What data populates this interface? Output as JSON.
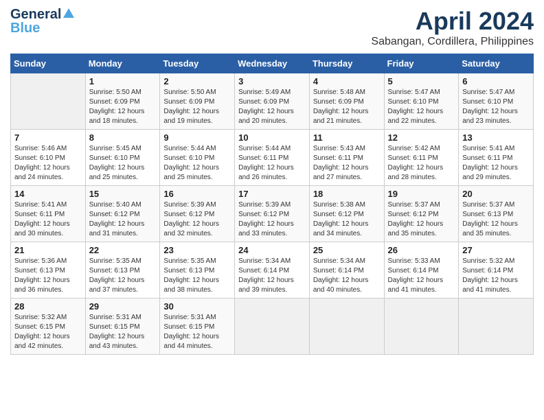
{
  "logo": {
    "line1": "General",
    "line2": "Blue"
  },
  "title": "April 2024",
  "subtitle": "Sabangan, Cordillera, Philippines",
  "days_of_week": [
    "Sunday",
    "Monday",
    "Tuesday",
    "Wednesday",
    "Thursday",
    "Friday",
    "Saturday"
  ],
  "weeks": [
    [
      {
        "num": "",
        "detail": ""
      },
      {
        "num": "1",
        "detail": "Sunrise: 5:50 AM\nSunset: 6:09 PM\nDaylight: 12 hours\nand 18 minutes."
      },
      {
        "num": "2",
        "detail": "Sunrise: 5:50 AM\nSunset: 6:09 PM\nDaylight: 12 hours\nand 19 minutes."
      },
      {
        "num": "3",
        "detail": "Sunrise: 5:49 AM\nSunset: 6:09 PM\nDaylight: 12 hours\nand 20 minutes."
      },
      {
        "num": "4",
        "detail": "Sunrise: 5:48 AM\nSunset: 6:09 PM\nDaylight: 12 hours\nand 21 minutes."
      },
      {
        "num": "5",
        "detail": "Sunrise: 5:47 AM\nSunset: 6:10 PM\nDaylight: 12 hours\nand 22 minutes."
      },
      {
        "num": "6",
        "detail": "Sunrise: 5:47 AM\nSunset: 6:10 PM\nDaylight: 12 hours\nand 23 minutes."
      }
    ],
    [
      {
        "num": "7",
        "detail": "Sunrise: 5:46 AM\nSunset: 6:10 PM\nDaylight: 12 hours\nand 24 minutes."
      },
      {
        "num": "8",
        "detail": "Sunrise: 5:45 AM\nSunset: 6:10 PM\nDaylight: 12 hours\nand 25 minutes."
      },
      {
        "num": "9",
        "detail": "Sunrise: 5:44 AM\nSunset: 6:10 PM\nDaylight: 12 hours\nand 25 minutes."
      },
      {
        "num": "10",
        "detail": "Sunrise: 5:44 AM\nSunset: 6:11 PM\nDaylight: 12 hours\nand 26 minutes."
      },
      {
        "num": "11",
        "detail": "Sunrise: 5:43 AM\nSunset: 6:11 PM\nDaylight: 12 hours\nand 27 minutes."
      },
      {
        "num": "12",
        "detail": "Sunrise: 5:42 AM\nSunset: 6:11 PM\nDaylight: 12 hours\nand 28 minutes."
      },
      {
        "num": "13",
        "detail": "Sunrise: 5:41 AM\nSunset: 6:11 PM\nDaylight: 12 hours\nand 29 minutes."
      }
    ],
    [
      {
        "num": "14",
        "detail": "Sunrise: 5:41 AM\nSunset: 6:11 PM\nDaylight: 12 hours\nand 30 minutes."
      },
      {
        "num": "15",
        "detail": "Sunrise: 5:40 AM\nSunset: 6:12 PM\nDaylight: 12 hours\nand 31 minutes."
      },
      {
        "num": "16",
        "detail": "Sunrise: 5:39 AM\nSunset: 6:12 PM\nDaylight: 12 hours\nand 32 minutes."
      },
      {
        "num": "17",
        "detail": "Sunrise: 5:39 AM\nSunset: 6:12 PM\nDaylight: 12 hours\nand 33 minutes."
      },
      {
        "num": "18",
        "detail": "Sunrise: 5:38 AM\nSunset: 6:12 PM\nDaylight: 12 hours\nand 34 minutes."
      },
      {
        "num": "19",
        "detail": "Sunrise: 5:37 AM\nSunset: 6:12 PM\nDaylight: 12 hours\nand 35 minutes."
      },
      {
        "num": "20",
        "detail": "Sunrise: 5:37 AM\nSunset: 6:13 PM\nDaylight: 12 hours\nand 35 minutes."
      }
    ],
    [
      {
        "num": "21",
        "detail": "Sunrise: 5:36 AM\nSunset: 6:13 PM\nDaylight: 12 hours\nand 36 minutes."
      },
      {
        "num": "22",
        "detail": "Sunrise: 5:35 AM\nSunset: 6:13 PM\nDaylight: 12 hours\nand 37 minutes."
      },
      {
        "num": "23",
        "detail": "Sunrise: 5:35 AM\nSunset: 6:13 PM\nDaylight: 12 hours\nand 38 minutes."
      },
      {
        "num": "24",
        "detail": "Sunrise: 5:34 AM\nSunset: 6:14 PM\nDaylight: 12 hours\nand 39 minutes."
      },
      {
        "num": "25",
        "detail": "Sunrise: 5:34 AM\nSunset: 6:14 PM\nDaylight: 12 hours\nand 40 minutes."
      },
      {
        "num": "26",
        "detail": "Sunrise: 5:33 AM\nSunset: 6:14 PM\nDaylight: 12 hours\nand 41 minutes."
      },
      {
        "num": "27",
        "detail": "Sunrise: 5:32 AM\nSunset: 6:14 PM\nDaylight: 12 hours\nand 41 minutes."
      }
    ],
    [
      {
        "num": "28",
        "detail": "Sunrise: 5:32 AM\nSunset: 6:15 PM\nDaylight: 12 hours\nand 42 minutes."
      },
      {
        "num": "29",
        "detail": "Sunrise: 5:31 AM\nSunset: 6:15 PM\nDaylight: 12 hours\nand 43 minutes."
      },
      {
        "num": "30",
        "detail": "Sunrise: 5:31 AM\nSunset: 6:15 PM\nDaylight: 12 hours\nand 44 minutes."
      },
      {
        "num": "",
        "detail": ""
      },
      {
        "num": "",
        "detail": ""
      },
      {
        "num": "",
        "detail": ""
      },
      {
        "num": "",
        "detail": ""
      }
    ]
  ]
}
